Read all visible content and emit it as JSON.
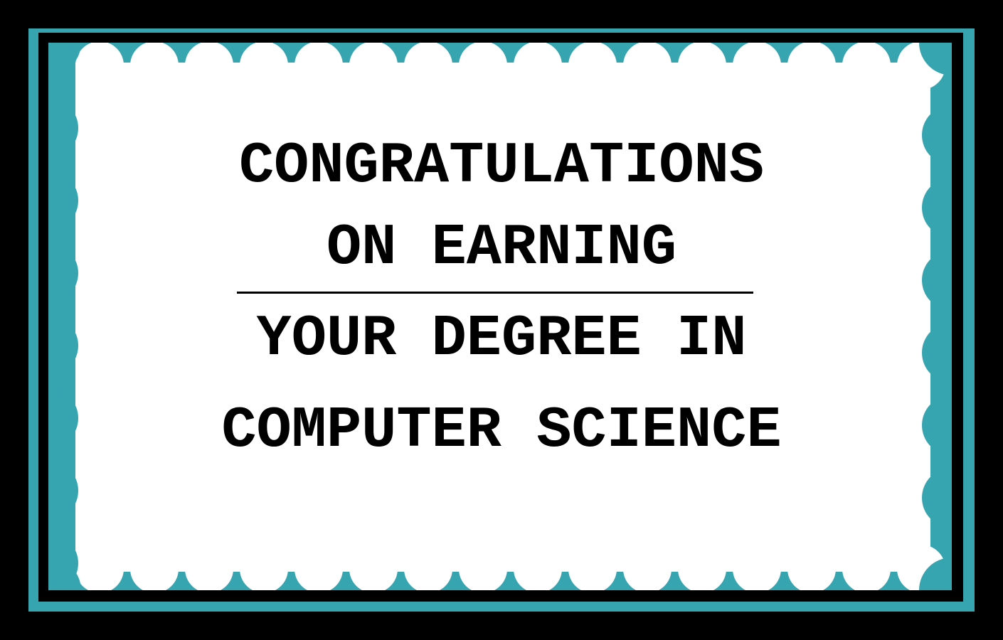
{
  "card": {
    "line1": "CONGRATULATIONS",
    "line2": "ON EARNING",
    "line3": "YOUR DEGREE IN",
    "line4": "COMPUTER SCIENCE"
  },
  "colors": {
    "background": "#000000",
    "border_accent": "#37A5B0",
    "panel": "#FFFFFF",
    "text": "#000000"
  }
}
